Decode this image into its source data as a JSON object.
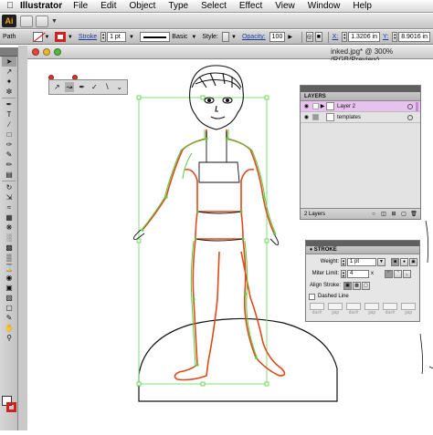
{
  "menubar": {
    "app_name": "Illustrator",
    "items": [
      "File",
      "Edit",
      "Object",
      "Type",
      "Select",
      "Effect",
      "View",
      "Window",
      "Help"
    ]
  },
  "appbar": {
    "logo": "Ai"
  },
  "controlbar": {
    "selection_label": "Path",
    "stroke_label": "Stroke",
    "stroke_weight": "1 pt",
    "brush_name": "Basic",
    "style_label": "Style:",
    "opacity_label": "Opacity:",
    "opacity_value": "100",
    "x_label": "X:",
    "x_value": "1.3206 in",
    "y_label": "Y:",
    "y_value": "8.9016 in",
    "fill_color": "none",
    "stroke_color": "#d21f1f"
  },
  "document": {
    "title": "inked.jpg* @ 300% (RGB/Preview)"
  },
  "layers_panel": {
    "title": "LAYERS",
    "layers": [
      {
        "name": "Layer 2",
        "color": "#e8c2ef",
        "selected": true
      },
      {
        "name": "templates",
        "color": "#ffffff",
        "selected": false
      }
    ],
    "count": "2 Layers"
  },
  "stroke_panel": {
    "title": "STROKE",
    "weight_label": "Weight:",
    "weight_value": "1 pt",
    "miter_label": "Miter Limit:",
    "miter_value": "4",
    "miter_unit": "x",
    "align_label": "Align Stroke:",
    "dashed_label": "Dashed Line",
    "dash_labels": [
      "dash",
      "gap",
      "dash",
      "gap",
      "dash",
      "gap"
    ]
  },
  "colors": {
    "path_orange": "#e0491a",
    "path_green": "#4fd03a",
    "selection_green": "#7fe07a",
    "ink": "#111111"
  },
  "icons": {
    "apple": "apple-icon",
    "tools": [
      "selection-tool-icon",
      "direct-selection-tool-icon",
      "magic-wand-icon",
      "lasso-icon",
      "pen-tool-icon",
      "type-tool-icon",
      "line-tool-icon",
      "rectangle-tool-icon",
      "paintbrush-icon",
      "pencil-icon",
      "blob-brush-icon",
      "eraser-icon",
      "rotate-icon",
      "scale-icon",
      "warp-icon",
      "free-transform-icon",
      "symbol-sprayer-icon",
      "column-graph-icon",
      "mesh-icon",
      "gradient-icon",
      "eyedropper-icon",
      "blend-icon",
      "live-paint-icon",
      "live-paint-select-icon",
      "artboard-icon",
      "slice-icon",
      "hand-icon",
      "zoom-icon"
    ]
  }
}
